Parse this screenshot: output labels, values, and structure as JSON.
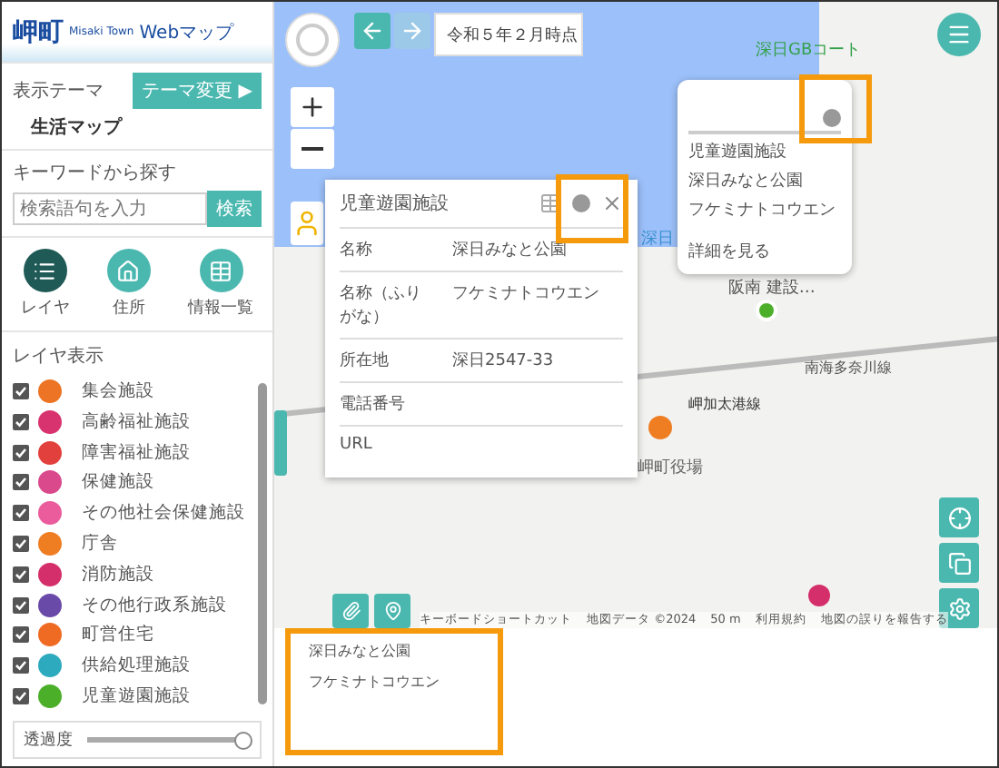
{
  "header": {
    "town": "岬町",
    "town_en": "Misaki Town",
    "product": "Webマップ"
  },
  "theme": {
    "label": "表示テーマ",
    "button": "テーマ変更 ▶",
    "value": "生活マップ"
  },
  "search": {
    "label": "キーワードから探す",
    "placeholder": "検索語句を入力",
    "button": "検索"
  },
  "nav": [
    {
      "kind": "list",
      "label": "レイヤ",
      "selected": true
    },
    {
      "kind": "home",
      "label": "住所",
      "selected": false
    },
    {
      "kind": "table",
      "label": "情報一覧",
      "selected": false
    }
  ],
  "layers": {
    "title": "レイヤ表示",
    "items": [
      {
        "label": "集会施設",
        "checked": true,
        "color": "#ec7424"
      },
      {
        "label": "高齢福祉施設",
        "checked": true,
        "color": "#d8336e"
      },
      {
        "label": "障害福祉施設",
        "checked": true,
        "color": "#e2403c"
      },
      {
        "label": "保健施設",
        "checked": true,
        "color": "#d9498c"
      },
      {
        "label": "その他社会保健施設",
        "checked": true,
        "color": "#ea5c9c"
      },
      {
        "label": "庁舎",
        "checked": true,
        "color": "#ef7d22"
      },
      {
        "label": "消防施設",
        "checked": true,
        "color": "#d42f6a"
      },
      {
        "label": "その他行政系施設",
        "checked": true,
        "color": "#6a4aa8"
      },
      {
        "label": "町営住宅",
        "checked": true,
        "color": "#ef6a22"
      },
      {
        "label": "供給処理施設",
        "checked": true,
        "color": "#2eaabf"
      },
      {
        "label": "児童遊園施設",
        "checked": true,
        "color": "#4caf2a"
      }
    ]
  },
  "opacity": {
    "label": "透過度",
    "level": 0.95
  },
  "map": {
    "date": "令和５年２月時点",
    "labels": [
      {
        "kind": "poi",
        "text": "深日GBコート"
      },
      {
        "kind": "poi",
        "text": "深日"
      },
      {
        "kind": "poi",
        "text": "阪南 建設…"
      },
      {
        "kind": "road",
        "text": "南海多奈川線"
      },
      {
        "kind": "road",
        "text": "岬加太港線"
      },
      {
        "kind": "poi",
        "text": "岬町役場"
      }
    ],
    "attribution": [
      "キーボードショートカット",
      "地図データ ©2024",
      "50 m",
      "利用規約",
      "地図の誤りを報告する"
    ]
  },
  "detail": {
    "title": "児童遊園施設",
    "rows": [
      {
        "label": "名称",
        "value": "深日みなと公園"
      },
      {
        "label": "名称（ふりがな）",
        "value": "フケミナトコウエン"
      },
      {
        "label": "所在地",
        "value": "深日2547-33"
      },
      {
        "label": "電話番号",
        "value": ""
      },
      {
        "label": "URL",
        "value": ""
      }
    ]
  },
  "mini": {
    "lines": [
      "児童遊園施設",
      "深日みなと公園",
      "フケミナトコウエン"
    ],
    "link": "詳細を見る"
  },
  "bottom": {
    "lines": [
      "深日みなと公園",
      "フケミナトコウエン"
    ]
  }
}
